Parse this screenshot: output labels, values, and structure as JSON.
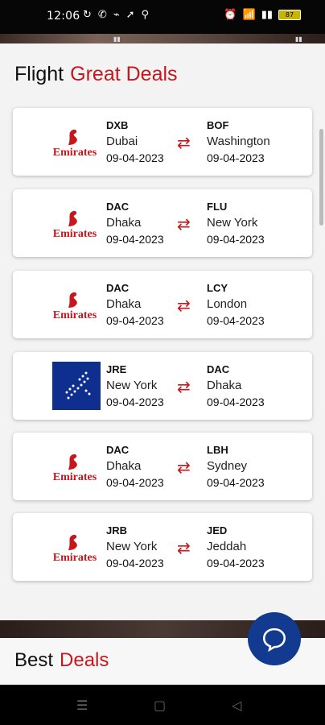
{
  "status_bar": {
    "time": "12:06",
    "left_icons": [
      "sync-icon",
      "phone-icon",
      "signal-icon",
      "location-icon",
      "bell-icon"
    ],
    "right_icons": [
      "alarm-icon",
      "wifi-icon",
      "signal-bars-icon"
    ],
    "battery_level": "87"
  },
  "section": {
    "title_main": "Flight",
    "title_accent": "Great Deals"
  },
  "deals": [
    {
      "airline": "Emirates",
      "from_code": "DXB",
      "from_city": "Dubai",
      "from_date": "09-04-2023",
      "to_code": "BOF",
      "to_city": "Washington",
      "to_date": "09-04-2023"
    },
    {
      "airline": "Emirates",
      "from_code": "DAC",
      "from_city": "Dhaka",
      "from_date": "09-04-2023",
      "to_code": "FLU",
      "to_city": "New York",
      "to_date": "09-04-2023"
    },
    {
      "airline": "Emirates",
      "from_code": "DAC",
      "from_city": "Dhaka",
      "from_date": "09-04-2023",
      "to_code": "LCY",
      "to_city": "London",
      "to_date": "09-04-2023"
    },
    {
      "airline": "blue-airline-logo",
      "from_code": "JRE",
      "from_city": "New York",
      "from_date": "09-04-2023",
      "to_code": "DAC",
      "to_city": "Dhaka",
      "to_date": "09-04-2023"
    },
    {
      "airline": "Emirates",
      "from_code": "DAC",
      "from_city": "Dhaka",
      "from_date": "09-04-2023",
      "to_code": "LBH",
      "to_city": "Sydney",
      "to_date": "09-04-2023"
    },
    {
      "airline": "Emirates",
      "from_code": "JRB",
      "from_city": "New York",
      "from_date": "09-04-2023",
      "to_code": "JED",
      "to_city": "Jeddah",
      "to_date": "09-04-2023"
    }
  ],
  "best": {
    "title_main": "Best",
    "title_accent": "Deals"
  },
  "colors": {
    "accent": "#c8161d",
    "chat_button": "#123a8f",
    "blue_logo": "#0f2f8f"
  },
  "nav": {
    "icons": [
      "recent-apps-icon",
      "home-icon",
      "back-icon"
    ]
  }
}
